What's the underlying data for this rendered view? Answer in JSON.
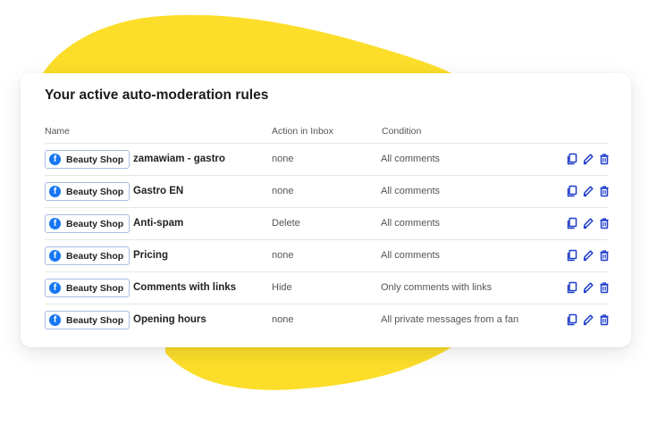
{
  "title": "Your active auto-moderation rules",
  "columns": {
    "name": "Name",
    "action": "Action in Inbox",
    "condition": "Condition"
  },
  "colors": {
    "blob": "#fcde2a",
    "facebook": "#1877f2",
    "icon": "#1e3ec9"
  },
  "rules": [
    {
      "page": "Beauty Shop",
      "page_icon": "facebook-icon",
      "name": "zamawiam - gastro",
      "action": "none",
      "condition": "All comments"
    },
    {
      "page": "Beauty Shop",
      "page_icon": "facebook-icon",
      "name": "Gastro EN",
      "action": "none",
      "condition": "All comments"
    },
    {
      "page": "Beauty Shop",
      "page_icon": "facebook-icon",
      "name": "Anti-spam",
      "action": "Delete",
      "condition": "All comments"
    },
    {
      "page": "Beauty Shop",
      "page_icon": "facebook-icon",
      "name": "Pricing",
      "action": "none",
      "condition": "All comments"
    },
    {
      "page": "Beauty Shop",
      "page_icon": "facebook-icon",
      "name": "Comments with links",
      "action": "Hide",
      "condition": "Only comments with links"
    },
    {
      "page": "Beauty Shop",
      "page_icon": "facebook-icon",
      "name": "Opening hours",
      "action": "none",
      "condition": "All private messages from a fan"
    }
  ],
  "row_actions": [
    "copy-icon",
    "edit-icon",
    "delete-icon"
  ]
}
